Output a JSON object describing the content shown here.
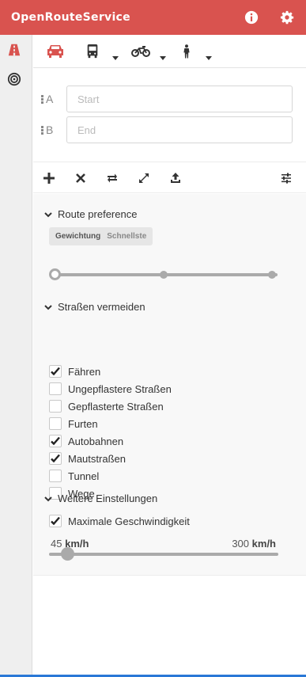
{
  "app": {
    "title": "OpenRouteService"
  },
  "header": {
    "info_icon": "info-circle-icon",
    "settings_icon": "gear-icon"
  },
  "leftbar": {
    "items": [
      {
        "name": "route-planner",
        "icon": "road-icon",
        "active": true
      },
      {
        "name": "accessibility",
        "icon": "target-icon",
        "active": false
      }
    ]
  },
  "modes": [
    {
      "name": "car",
      "icon": "car-icon",
      "active": true,
      "has_menu": false
    },
    {
      "name": "bus",
      "icon": "bus-icon",
      "active": false,
      "has_menu": true
    },
    {
      "name": "bike",
      "icon": "bicycle-icon",
      "active": false,
      "has_menu": true
    },
    {
      "name": "pedestrian",
      "icon": "pedestrian-icon",
      "active": false,
      "has_menu": true
    }
  ],
  "waypoints": [
    {
      "label": "A",
      "placeholder": "Start",
      "value": ""
    },
    {
      "label": "B",
      "placeholder": "End",
      "value": ""
    }
  ],
  "toolbar": {
    "left": [
      "add-waypoint-icon",
      "reset-icon",
      "reverse-route-icon",
      "zoom-to-route-icon",
      "upload-icon"
    ],
    "right": "options-sliders-icon"
  },
  "route_preference": {
    "title": "Route preference",
    "weighting_label": "Gewichtung",
    "weighting_value": "Schnellste",
    "slider_steps": 3,
    "slider_value_index": 0
  },
  "avoid": {
    "title": "Straßen vermeiden",
    "items": [
      {
        "label": "Fähren",
        "checked": true
      },
      {
        "label": "Ungepflastere Straßen",
        "checked": false
      },
      {
        "label": "Gepflasterte Straßen",
        "checked": false
      },
      {
        "label": "Furten",
        "checked": false
      },
      {
        "label": "Autobahnen",
        "checked": true
      },
      {
        "label": "Mautstraßen",
        "checked": true
      },
      {
        "label": "Tunnel",
        "checked": false
      },
      {
        "label": "Wege",
        "checked": false
      }
    ]
  },
  "more": {
    "title": "Weitere Einstellungen",
    "max_speed_label": "Maximale Geschwindigkeit",
    "max_speed_checked": true,
    "min_value": "45",
    "max_value": "300",
    "unit": "km/h",
    "slider_fraction": 0.08
  },
  "colors": {
    "accent": "#d9534f",
    "header_text": "#ffffff"
  }
}
